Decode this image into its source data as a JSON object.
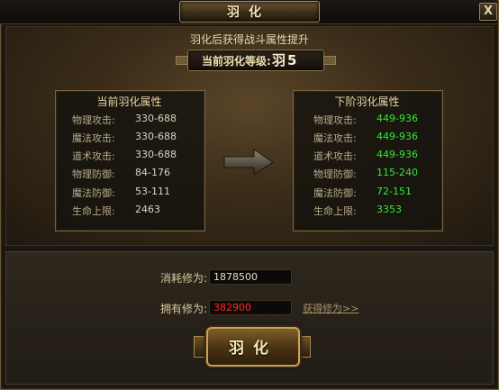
{
  "window": {
    "title": "羽化",
    "close_label": "X"
  },
  "header": {
    "subtitle": "羽化后获得战斗属性提升",
    "level_label": "当前羽化等级:",
    "level_value": "羽5"
  },
  "current": {
    "title": "当前羽化属性",
    "rows": [
      {
        "label": "物理攻击:",
        "value": "330-688"
      },
      {
        "label": "魔法攻击:",
        "value": "330-688"
      },
      {
        "label": "道术攻击:",
        "value": "330-688"
      },
      {
        "label": "物理防御:",
        "value": "84-176"
      },
      {
        "label": "魔法防御:",
        "value": "53-111"
      },
      {
        "label": "生命上限:",
        "value": "2463"
      }
    ]
  },
  "next": {
    "title": "下阶羽化属性",
    "rows": [
      {
        "label": "物理攻击:",
        "value": "449-936"
      },
      {
        "label": "魔法攻击:",
        "value": "449-936"
      },
      {
        "label": "道术攻击:",
        "value": "449-936"
      },
      {
        "label": "物理防御:",
        "value": "115-240"
      },
      {
        "label": "魔法防御:",
        "value": "72-151"
      },
      {
        "label": "生命上限:",
        "value": "3353"
      }
    ]
  },
  "cost": {
    "label": "消耗修为:",
    "value": "1878500"
  },
  "owned": {
    "label": "拥有修为:",
    "value": "382900",
    "value_color": "#ff2b2b"
  },
  "get_link": "获得修为>>",
  "action_button": "羽化",
  "icons": {
    "arrow": "right-arrow-icon",
    "close": "close-icon"
  }
}
